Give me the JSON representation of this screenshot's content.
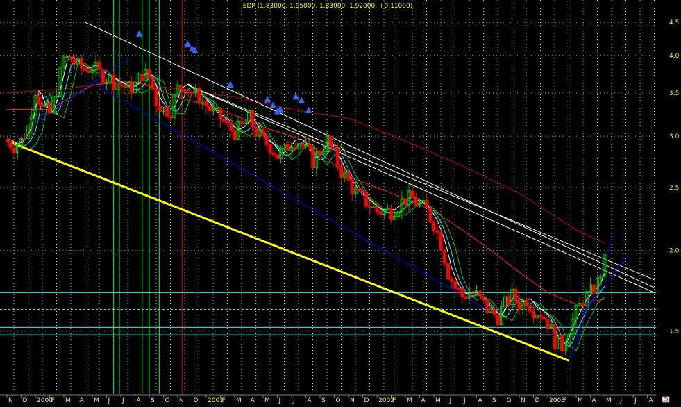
{
  "chart_data": {
    "type": "candlestick",
    "title": "EDP (1.83000, 1.95000, 1.83000, 1.92000, +0.11000)",
    "y_scale": "log",
    "ylim": [
      1.2,
      4.8
    ],
    "y_ticks": [
      {
        "value": 4.5,
        "label": "4.5"
      },
      {
        "value": 4.0,
        "label": "4.0"
      },
      {
        "value": 3.5,
        "label": "3.5"
      },
      {
        "value": 3.0,
        "label": "3.0"
      },
      {
        "value": 2.5,
        "label": "2.5"
      },
      {
        "value": 2.0,
        "label": "2.0"
      },
      {
        "value": 1.5,
        "label": "1.5"
      }
    ],
    "x_months": [
      "N",
      "D",
      "2000",
      "F",
      "M",
      "A",
      "M",
      "J",
      "J",
      "A",
      "S",
      "O",
      "N",
      "D",
      "2001",
      "F",
      "M",
      "A",
      "M",
      "J",
      "J",
      "A",
      "S",
      "O",
      "N",
      "D",
      "2002",
      "F",
      "M",
      "A",
      "M",
      "J",
      "J",
      "A",
      "S",
      "O",
      "N",
      "D",
      "2003",
      "F",
      "M",
      "A",
      "M",
      "J",
      "J",
      "A"
    ],
    "x_start_month_index": 0,
    "close_path": [
      [
        0.0,
        2.95
      ],
      [
        0.5,
        2.9
      ],
      [
        1.0,
        2.95
      ],
      [
        1.5,
        3.1
      ],
      [
        2.0,
        3.55
      ],
      [
        2.5,
        3.3
      ],
      [
        3.0,
        3.25
      ],
      [
        3.5,
        3.55
      ],
      [
        4.0,
        3.95
      ],
      [
        4.5,
        3.95
      ],
      [
        5.0,
        3.85
      ],
      [
        5.5,
        3.8
      ],
      [
        6.0,
        3.85
      ],
      [
        6.5,
        3.75
      ],
      [
        7.0,
        3.7
      ],
      [
        7.5,
        3.65
      ],
      [
        8.0,
        3.6
      ],
      [
        8.5,
        3.55
      ],
      [
        9.0,
        3.6
      ],
      [
        9.5,
        3.75
      ],
      [
        10.0,
        3.7
      ],
      [
        10.5,
        3.4
      ],
      [
        11.0,
        3.3
      ],
      [
        11.5,
        3.3
      ],
      [
        12.0,
        3.55
      ],
      [
        12.5,
        3.6
      ],
      [
        13.0,
        3.5
      ],
      [
        13.5,
        3.45
      ],
      [
        14.0,
        3.35
      ],
      [
        14.5,
        3.25
      ],
      [
        15.0,
        3.2
      ],
      [
        15.5,
        3.1
      ],
      [
        16.0,
        3.05
      ],
      [
        16.5,
        3.1
      ],
      [
        17.0,
        3.2
      ],
      [
        17.5,
        3.05
      ],
      [
        18.0,
        2.95
      ],
      [
        18.5,
        2.9
      ],
      [
        19.0,
        2.8
      ],
      [
        19.5,
        2.85
      ],
      [
        20.0,
        2.95
      ],
      [
        20.5,
        2.95
      ],
      [
        21.0,
        2.85
      ],
      [
        21.5,
        2.75
      ],
      [
        22.0,
        2.85
      ],
      [
        22.5,
        2.95
      ],
      [
        23.0,
        2.8
      ],
      [
        23.5,
        2.65
      ],
      [
        24.0,
        2.55
      ],
      [
        24.5,
        2.45
      ],
      [
        25.0,
        2.4
      ],
      [
        25.5,
        2.35
      ],
      [
        26.0,
        2.3
      ],
      [
        26.5,
        2.3
      ],
      [
        27.0,
        2.3
      ],
      [
        27.5,
        2.35
      ],
      [
        28.0,
        2.4
      ],
      [
        28.5,
        2.4
      ],
      [
        29.0,
        2.35
      ],
      [
        29.5,
        2.3
      ],
      [
        30.0,
        2.2
      ],
      [
        30.5,
        2.05
      ],
      [
        31.0,
        1.85
      ],
      [
        31.5,
        1.75
      ],
      [
        32.0,
        1.7
      ],
      [
        32.5,
        1.72
      ],
      [
        33.0,
        1.7
      ],
      [
        33.5,
        1.65
      ],
      [
        34.0,
        1.6
      ],
      [
        34.5,
        1.58
      ],
      [
        35.0,
        1.65
      ],
      [
        35.5,
        1.7
      ],
      [
        36.0,
        1.65
      ],
      [
        36.5,
        1.68
      ],
      [
        37.0,
        1.62
      ],
      [
        37.5,
        1.6
      ],
      [
        38.0,
        1.55
      ],
      [
        38.5,
        1.45
      ],
      [
        39.0,
        1.42
      ],
      [
        39.5,
        1.52
      ],
      [
        40.0,
        1.6
      ],
      [
        40.5,
        1.68
      ],
      [
        41.0,
        1.72
      ],
      [
        41.5,
        1.78
      ],
      [
        42.0,
        1.92
      ]
    ],
    "blue_markers": [
      9.3,
      12.7,
      13.0,
      13.2,
      15.7,
      18.3,
      18.7,
      19.0,
      19.2,
      20.3,
      20.7,
      21.2
    ],
    "channel_lines": [
      {
        "color": "#ffff00",
        "width": 3,
        "from": [
          0,
          2.95
        ],
        "to": [
          39.5,
          1.35
        ]
      },
      {
        "color": "#ffffff",
        "width": 1,
        "from": [
          5.5,
          4.5
        ],
        "to": [
          45.5,
          1.75
        ]
      },
      {
        "color": "#ffffff",
        "width": 1,
        "from": [
          12.7,
          3.6
        ],
        "to": [
          45.5,
          1.72
        ]
      },
      {
        "color": "#ffffcc",
        "width": 1,
        "from": [
          12.7,
          3.6
        ],
        "to": [
          45.5,
          1.8
        ]
      },
      {
        "color": "#0000ff",
        "width": 1,
        "from": [
          5.8,
          3.65
        ],
        "to": [
          33.5,
          1.63
        ]
      },
      {
        "color": "#0000ff",
        "width": 1,
        "from": [
          1.5,
          3.1
        ],
        "to": [
          8.5,
          3.95
        ]
      },
      {
        "color": "#0000ff",
        "width": 1,
        "from": [
          39.5,
          1.35
        ],
        "to": [
          42.6,
          2.1
        ]
      },
      {
        "color": "#0000ff",
        "width": 1,
        "from": [
          40.5,
          1.6
        ],
        "to": [
          43.5,
          1.95
        ]
      }
    ],
    "horizontal_levels": [
      {
        "value": 1.72,
        "color": "#00ffff",
        "dashed": false
      },
      {
        "value": 1.62,
        "color": "#00ffff",
        "dashed": true
      },
      {
        "value": 1.52,
        "color": "#00ffff",
        "dashed": false
      },
      {
        "value": 1.48,
        "color": "#00ffff",
        "dashed": false
      }
    ],
    "vertical_markers": [
      {
        "month": 7.5,
        "color": "#00ff00"
      },
      {
        "month": 7.9,
        "color": "#00ff00"
      },
      {
        "month": 9.5,
        "color": "#00ff00"
      },
      {
        "month": 10.0,
        "color": "#00ff00"
      },
      {
        "month": 10.7,
        "color": "#00ff00"
      },
      {
        "month": 12.3,
        "color": "#ff0000"
      }
    ],
    "long_ma": [
      [
        0,
        3.5
      ],
      [
        4,
        3.55
      ],
      [
        8,
        3.65
      ],
      [
        12,
        3.55
      ],
      [
        16,
        3.45
      ],
      [
        20,
        3.3
      ],
      [
        24,
        3.2
      ],
      [
        28,
        2.95
      ],
      [
        32,
        2.7
      ],
      [
        36,
        2.45
      ],
      [
        40,
        2.15
      ],
      [
        42,
        2.05
      ]
    ],
    "mid_ma": [
      [
        0,
        3.3
      ],
      [
        3,
        3.3
      ],
      [
        6,
        3.6
      ],
      [
        9,
        3.65
      ],
      [
        12,
        3.45
      ],
      [
        15,
        3.3
      ],
      [
        18,
        3.1
      ],
      [
        21,
        2.95
      ],
      [
        24,
        2.6
      ],
      [
        27,
        2.45
      ],
      [
        30,
        2.3
      ],
      [
        32,
        2.15
      ],
      [
        34,
        2.0
      ],
      [
        36,
        1.85
      ],
      [
        38,
        1.72
      ],
      [
        40,
        1.65
      ],
      [
        42,
        1.68
      ]
    ]
  }
}
